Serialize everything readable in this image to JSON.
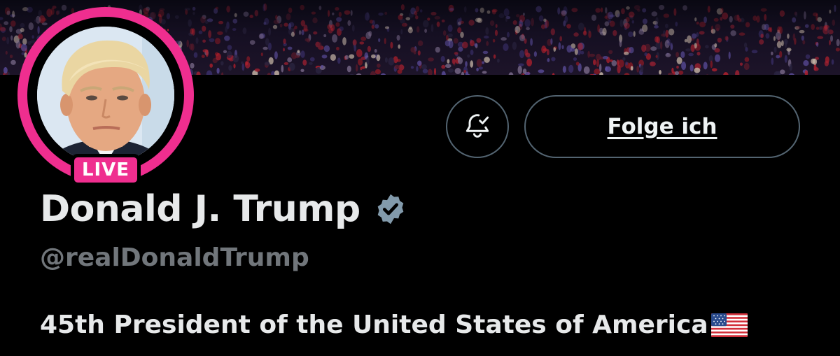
{
  "profile": {
    "display_name": "Donald J. Trump",
    "handle": "@realDonaldTrump",
    "bio": "45th President of the United States of America",
    "bio_emoji": "us-flag-icon",
    "live_badge": "LIVE",
    "verified": true
  },
  "actions": {
    "follow_label": "Folge ich",
    "notify_icon": "bell-check-icon"
  },
  "colors": {
    "background": "#000000",
    "live_accent": "#ef2e8f",
    "verified_badge": "#829aab",
    "handle_text": "#71767b",
    "button_border": "#536471"
  }
}
